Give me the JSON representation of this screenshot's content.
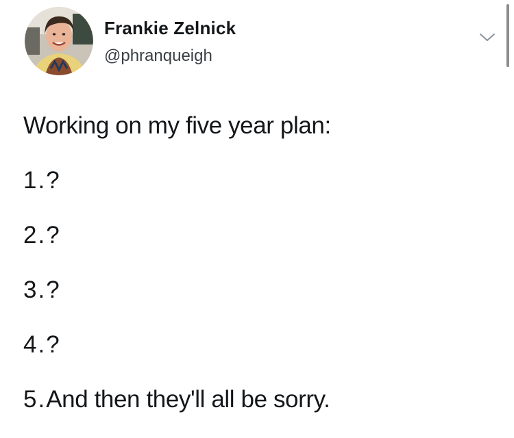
{
  "user": {
    "display_name": "Frankie Zelnick",
    "handle": "@phranqueigh",
    "avatar": "profile-photo"
  },
  "menu": {
    "icon": "chevron-down-icon"
  },
  "tweet": {
    "intro": "Working on my five year plan:",
    "items": [
      {
        "number": "1.",
        "text": "?"
      },
      {
        "number": "2.",
        "text": "?"
      },
      {
        "number": "3.",
        "text": "?"
      },
      {
        "number": "4.",
        "text": "?"
      },
      {
        "number": "5.",
        "text": "And then they'll all be sorry."
      }
    ]
  },
  "colors": {
    "background": "#ffffff",
    "text": "#14171a",
    "secondary_text": "#3a3f44"
  }
}
